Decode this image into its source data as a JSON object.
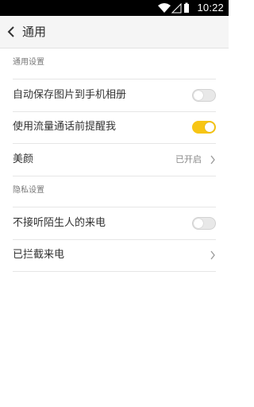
{
  "status_bar": {
    "time": "10:22"
  },
  "header": {
    "title": "通用"
  },
  "sections": {
    "general": {
      "title": "通用设置",
      "items": [
        {
          "label": "自动保存图片到手机相册",
          "toggle": "off"
        },
        {
          "label": "使用流量通话前提醒我",
          "toggle": "on"
        },
        {
          "label": "美颜",
          "value": "已开启"
        }
      ]
    },
    "privacy": {
      "title": "隐私设置",
      "items": [
        {
          "label": "不接听陌生人的来电",
          "toggle": "off"
        },
        {
          "label": "已拦截来电"
        }
      ]
    }
  },
  "colors": {
    "accent": "#f7c514",
    "header_bg": "#f5f5f5"
  }
}
